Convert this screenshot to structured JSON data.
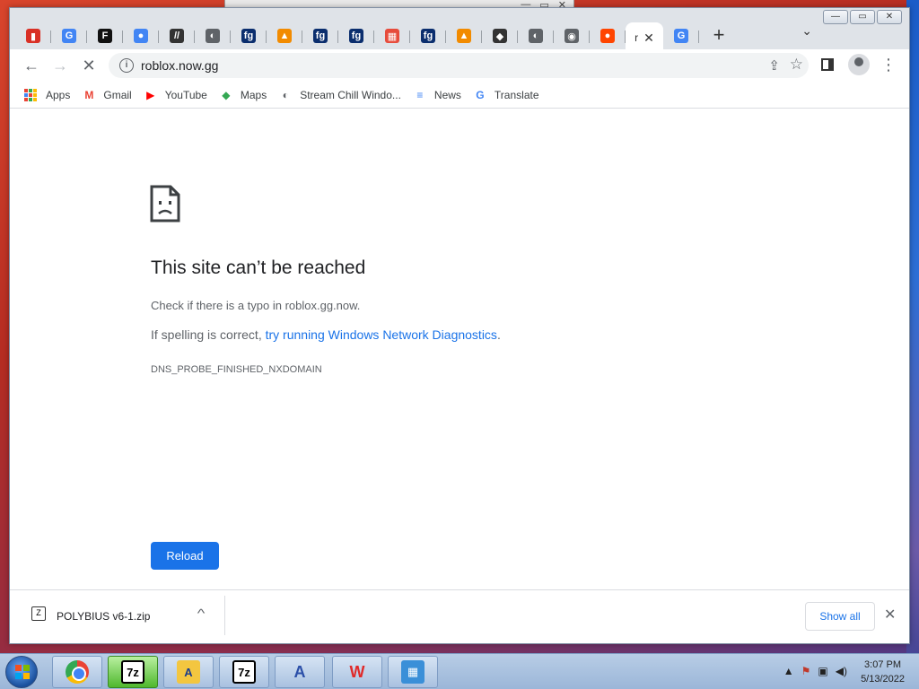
{
  "browser": {
    "tabs": [
      {
        "favicon": "pdf-red-icon",
        "color": "#d93025",
        "glyph": "▮"
      },
      {
        "favicon": "google-icon",
        "color": "#4285f4",
        "glyph": "G"
      },
      {
        "favicon": "f-logo-icon",
        "color": "#111111",
        "glyph": "F"
      },
      {
        "favicon": "pin-icon",
        "color": "#4285f4",
        "glyph": "●"
      },
      {
        "favicon": "w-slash-icon",
        "color": "#333333",
        "glyph": "//"
      },
      {
        "favicon": "globe-icon",
        "color": "#5f6368",
        "glyph": "◐"
      },
      {
        "favicon": "fg-icon",
        "color": "#0b2e6e",
        "glyph": "fg"
      },
      {
        "favicon": "vlc-icon",
        "color": "#f28b00",
        "glyph": "▲"
      },
      {
        "favicon": "fg-icon",
        "color": "#0b2e6e",
        "glyph": "fg"
      },
      {
        "favicon": "fg-icon",
        "color": "#0b2e6e",
        "glyph": "fg"
      },
      {
        "favicon": "colorful-icon",
        "color": "#e74c3c",
        "glyph": "▦"
      },
      {
        "favicon": "fg-icon",
        "color": "#0b2e6e",
        "glyph": "fg"
      },
      {
        "favicon": "vlc-icon",
        "color": "#f28b00",
        "glyph": "▲"
      },
      {
        "favicon": "shield-icon",
        "color": "#333333",
        "glyph": "◆"
      },
      {
        "favicon": "globe-icon",
        "color": "#5f6368",
        "glyph": "◐"
      },
      {
        "favicon": "chrome-icon",
        "color": "#5f6368",
        "glyph": "◉"
      },
      {
        "favicon": "reddit-icon",
        "color": "#ff4500",
        "glyph": "●"
      }
    ],
    "active_tab": {
      "title": "r",
      "close": "✕"
    },
    "last_tab": {
      "favicon": "google-icon",
      "glyph": "G"
    },
    "new_tab": "+",
    "tab_search": "⌄",
    "window_controls": {
      "min": "—",
      "max": "▭",
      "close": "✕"
    },
    "nav": {
      "back": "←",
      "forward": "→",
      "reload": "✕"
    },
    "url": "roblox.now.gg",
    "menu": "⋮",
    "bookmarks": [
      {
        "label": "Apps",
        "icon": "apps-grid-icon"
      },
      {
        "label": "Gmail",
        "icon": "gmail-icon",
        "color": "#ea4335",
        "glyph": "M"
      },
      {
        "label": "YouTube",
        "icon": "youtube-icon",
        "color": "#ff0000",
        "glyph": "▶"
      },
      {
        "label": "Maps",
        "icon": "maps-icon",
        "color": "#34a853",
        "glyph": "◆"
      },
      {
        "label": "Stream Chill Windo...",
        "icon": "globe-icon",
        "color": "#5f6368",
        "glyph": "◐"
      },
      {
        "label": "News",
        "icon": "news-icon",
        "color": "#4285f4",
        "glyph": "≡"
      },
      {
        "label": "Translate",
        "icon": "translate-icon",
        "color": "#4285f4",
        "glyph": "G"
      }
    ]
  },
  "error_page": {
    "title": "This site can’t be reached",
    "typo_message": "Check if there is a typo in roblox.gg.now.",
    "spelling_prefix": "If spelling is correct, ",
    "diagnostics_link": "try running Windows Network Diagnostics",
    "spelling_suffix": ".",
    "error_code": "DNS_PROBE_FINISHED_NXDOMAIN",
    "reload_label": "Reload"
  },
  "downloads": {
    "file_name": "POLYBIUS v6-1.zip",
    "chevron": "^",
    "show_all": "Show all",
    "close": "✕"
  },
  "taskbar": {
    "apps": [
      {
        "name": "chrome",
        "label": ""
      },
      {
        "name": "7zip",
        "label": "7z"
      },
      {
        "name": "file-explorer",
        "label": "A"
      },
      {
        "name": "7zip",
        "label": "7z"
      },
      {
        "name": "vector-app",
        "label": "A"
      },
      {
        "name": "wps-office",
        "label": "W"
      },
      {
        "name": "folder-app",
        "label": "▦"
      }
    ],
    "tray": {
      "arrow": "▲",
      "flag": "⚑",
      "network": "▣",
      "volume": "◀)"
    },
    "time": "3:07 PM",
    "date": "5/13/2022"
  }
}
